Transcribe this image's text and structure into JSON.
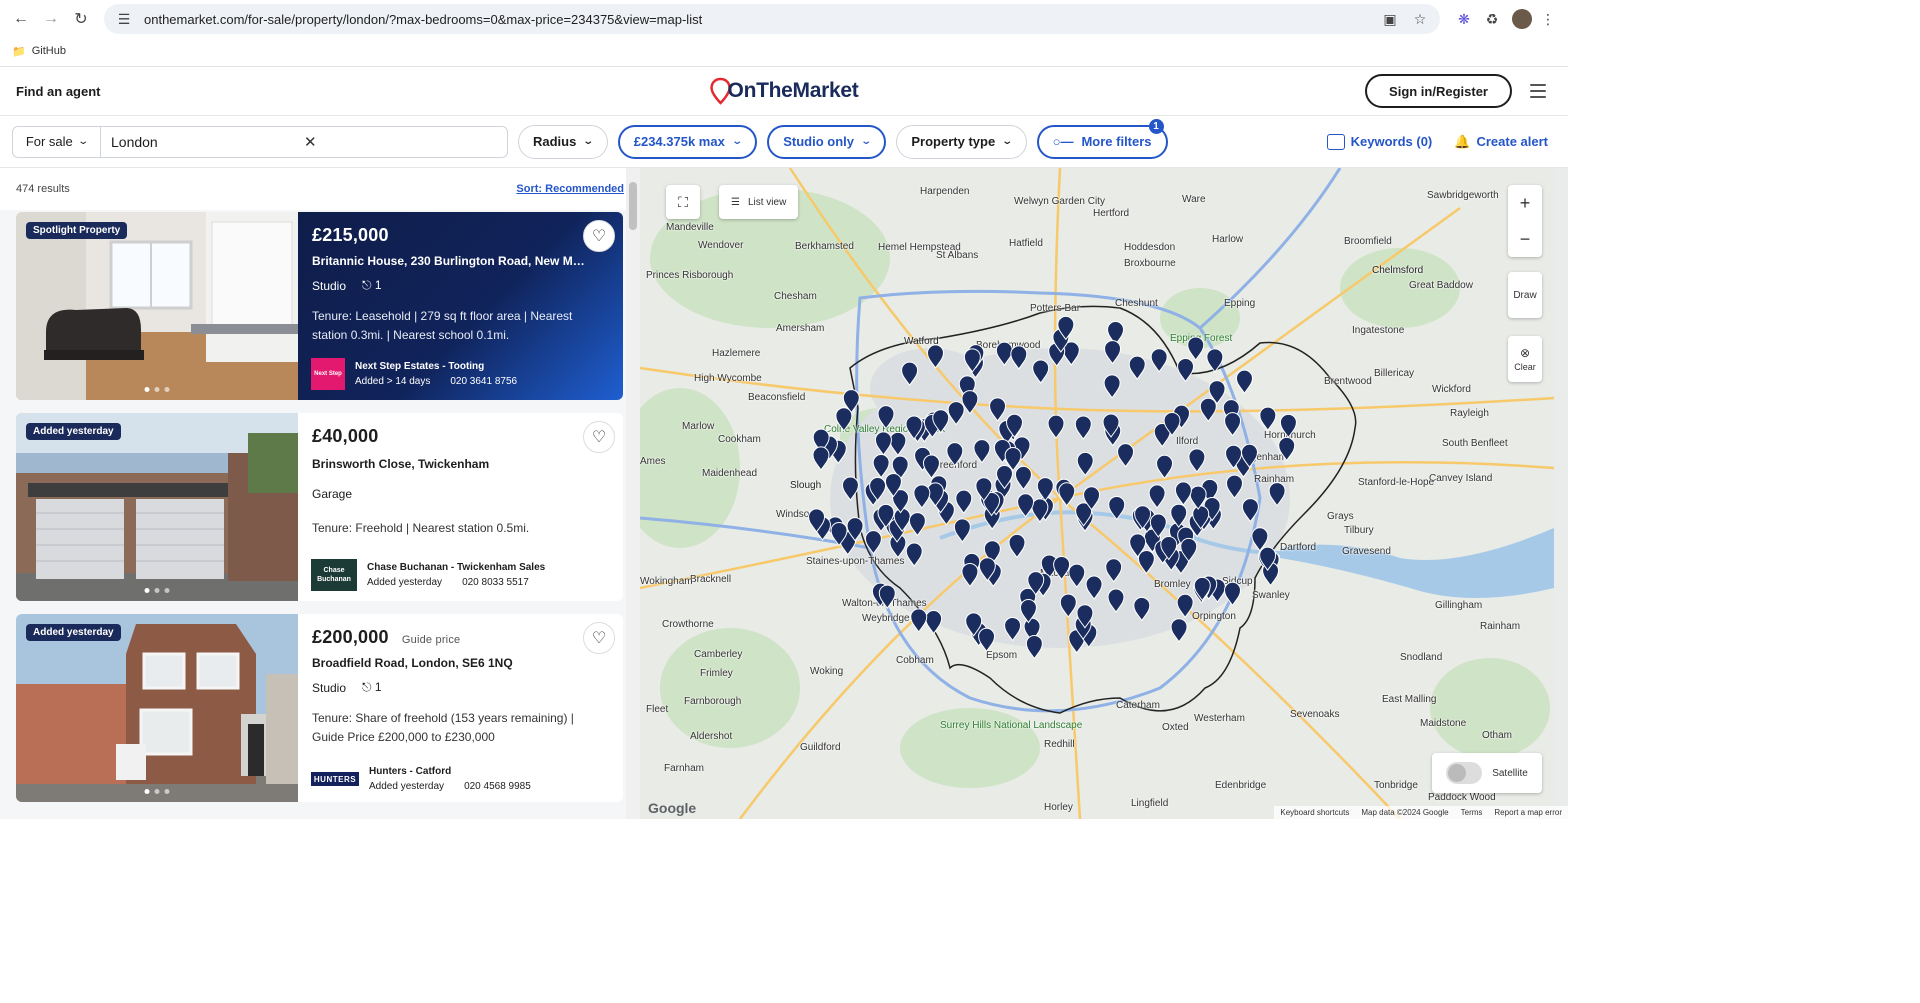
{
  "browser": {
    "url": "onthemarket.com/for-sale/property/london/?max-bedrooms=0&max-price=234375&view=map-list",
    "bookmark": "GitHub"
  },
  "header": {
    "find_agent": "Find an agent",
    "logo": "OnTheMarket",
    "sign_in": "Sign in/Register"
  },
  "filters": {
    "for_sale": "For sale",
    "location": "London",
    "radius": "Radius",
    "price": "£234.375k max",
    "bedrooms": "Studio only",
    "property_type": "Property type",
    "more_filters": "More filters",
    "more_filters_count": "1",
    "keywords": "Keywords (0)",
    "create_alert": "Create alert"
  },
  "results": {
    "count": "474 results",
    "sort": "Sort: Recommended"
  },
  "listings": [
    {
      "tag": "Spotlight Property",
      "price": "£215,000",
      "guide": "",
      "address": "Britannic House, 230 Burlington Road, New Mal...",
      "type": "Studio",
      "baths": "1",
      "desc": "Tenure: Leasehold | 279 sq ft floor area | Nearest station 0.3mi. | Nearest school 0.1mi.",
      "agent": "Next Step Estates - Tooting",
      "added": "Added > 14 days",
      "phone": "020 3641 8756",
      "agent_logo": "Next Step"
    },
    {
      "tag": "Added yesterday",
      "price": "£40,000",
      "guide": "",
      "address": "Brinsworth Close, Twickenham",
      "type": "Garage",
      "baths": "",
      "desc": "Tenure: Freehold | Nearest station 0.5mi.",
      "agent": "Chase Buchanan - Twickenham Sales",
      "added": "Added yesterday",
      "phone": "020 8033 5517",
      "agent_logo": "Chase Buchanan"
    },
    {
      "tag": "Added yesterday",
      "price": "£200,000",
      "guide": "Guide price",
      "address": "Broadfield Road, London, SE6 1NQ",
      "type": "Studio",
      "baths": "1",
      "desc": "Tenure: Share of freehold (153 years remaining) | Guide Price £200,000 to £230,000",
      "agent": "Hunters - Catford",
      "added": "Added yesterday",
      "phone": "020 4568 9985",
      "agent_logo": "HUNTERS"
    }
  ],
  "map": {
    "list_view": "List view",
    "draw": "Draw",
    "clear": "Clear",
    "satellite": "Satellite",
    "google": "Google",
    "attribution": [
      "Keyboard shortcuts",
      "Map data ©2024 Google",
      "Terms",
      "Report a map error"
    ],
    "places": [
      "Harpenden",
      "Welwyn Garden City",
      "Hertford",
      "Ware",
      "Sawbridgeworth",
      "Mandeville",
      "Wendover",
      "Berkhamsted",
      "Hemel Hempstead",
      "St Albans",
      "Hatfield",
      "Hoddesdon",
      "Harlow",
      "Broxbourne",
      "Broomfield",
      "Chelmsford",
      "Great Baddow",
      "Princes Risborough",
      "Chesham",
      "Potters Bar",
      "Cheshunt",
      "Epping",
      "Amersham",
      "Watford",
      "Borehamwood",
      "Epping Forest",
      "Ingatestone",
      "High Wycombe",
      "Hazlemere",
      "Billericay",
      "Brentwood",
      "Beaconsfield",
      "Wickford",
      "Rayleigh",
      "Marlow",
      "Cookham",
      "Colne Valley Regional Park",
      "Hornchurch",
      "Ilford",
      "Dagenham",
      "South Benfleet",
      "Maidenhead",
      "Slough",
      "Greenford",
      "Windsor",
      "Rainham",
      "Canvey Island",
      "Stanford-le-Hope",
      "Grays",
      "Tilbury",
      "Dartford",
      "Gravesend",
      "Staines-upon-Thames",
      "Bracknell",
      "Wokingham",
      "Walton-on-Thames",
      "Weybridge",
      "Mitcham",
      "Bromley",
      "Sidcup",
      "Swanley",
      "Gillingham",
      "Orpington",
      "Crowthorne",
      "Camberley",
      "Frimley",
      "Woking",
      "Cobham",
      "Epsom",
      "Farnborough",
      "Fleet",
      "Aldershot",
      "Guildford",
      "Surrey Hills National Landscape",
      "Redhill",
      "Caterham",
      "Oxted",
      "Westerham",
      "Sevenoaks",
      "East Malling",
      "Maidstone",
      "Snodland",
      "Rainham",
      "Otham",
      "Farnham",
      "Horley",
      "Lingfield",
      "Edenbridge",
      "Tonbridge",
      "Paddock Wood",
      "Ames"
    ]
  },
  "colors": {
    "accent": "#2456c9",
    "brand_navy": "#1a2a5a",
    "pin": "#1a2d5e",
    "logo_red": "#e4292f"
  }
}
